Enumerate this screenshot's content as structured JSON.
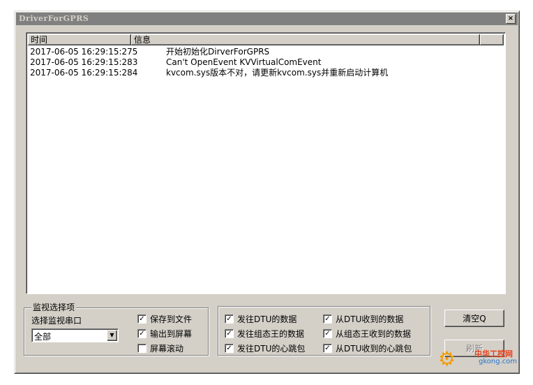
{
  "window": {
    "title": "DriverForGPRS",
    "close_glyph": "×"
  },
  "log": {
    "columns": [
      "时间",
      "信息"
    ],
    "rows": [
      {
        "time": "2017-06-05 16:29:15:275",
        "info": "开始初始化DirverForGPRS"
      },
      {
        "time": "2017-06-05 16:29:15:283",
        "info": "Can't OpenEvent KVVirtualComEvent"
      },
      {
        "time": "2017-06-05 16:29:15:284",
        "info": "kvcom.sys版本不对，请更新kvcom.sys并重新启动计算机"
      }
    ]
  },
  "monitor": {
    "group_title": "监视选择项",
    "port_label": "选择监视串口",
    "port_value": "全部",
    "options": [
      {
        "label": "保存到文件",
        "checked": true
      },
      {
        "label": "输出到屏幕",
        "checked": true
      },
      {
        "label": "屏幕滚动",
        "checked": false
      }
    ]
  },
  "data_filters": [
    {
      "label": "发往DTU的数据",
      "checked": true
    },
    {
      "label": "从DTU收到的数据",
      "checked": true
    },
    {
      "label": "发往组态王的数据",
      "checked": true
    },
    {
      "label": "从组态王收到的数据",
      "checked": true
    },
    {
      "label": "发往DTU的心跳包",
      "checked": true
    },
    {
      "label": "从DTU收到的心跳包",
      "checked": true
    }
  ],
  "buttons": {
    "clear": "清空Q",
    "refresh": "刷新"
  },
  "watermark": {
    "line1": "中华工控网",
    "line2": "gkong.com",
    "icon": "gear-icon",
    "colors": {
      "gear": "#f29a00",
      "text": "#e8401a",
      "url": "#2a74c8"
    }
  }
}
